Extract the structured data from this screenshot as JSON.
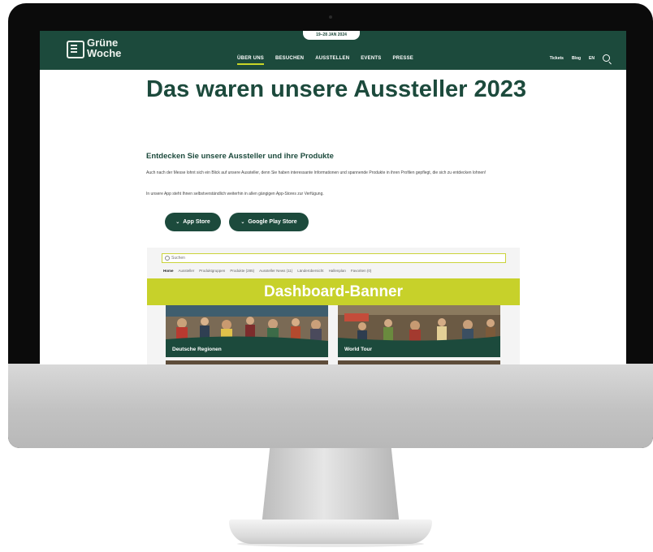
{
  "site": {
    "logo_line1": "Grüne",
    "logo_line2": "Woche",
    "date_badge": "19–28 JAN 2024",
    "menu": [
      "ÜBER UNS",
      "BESUCHEN",
      "AUSSTELLEN",
      "EVENTS",
      "PRESSE"
    ],
    "utility": {
      "tickets": "Tickets",
      "blog": "Blog",
      "lang": "EN"
    }
  },
  "content": {
    "title": "Das waren unsere Aussteller 2023",
    "subtitle": "Entdecken Sie unsere Aussteller und ihre Produkte",
    "paragraph1": "Auch nach der Messe lohnt sich ein Blick auf unsere Aussteller, denn Sie haben interessante Informationen und spannende Produkte in ihren Profilen gepflegt, die sich zu entdecken lohnen!",
    "paragraph2": "In unsere App steht Ihnen selbstverständlich weiterhin in allen gängigen App-Stores zur Verfügung.",
    "buttons": {
      "app_store": "App Store",
      "google_play": "Google Play Store"
    }
  },
  "embed": {
    "search_placeholder": "Suchen",
    "tabs": [
      "Home",
      "Aussteller",
      "Produktgruppen",
      "Produkte (285)",
      "Aussteller News (11)",
      "Länderübersicht",
      "Hallenplan",
      "Favoriten (0)"
    ],
    "banner": "Dashboard-Banner",
    "cards": [
      "Deutsche Regionen",
      "World Tour"
    ]
  },
  "colors": {
    "brand_green": "#1c4a3c",
    "accent_lime": "#c7d12a"
  }
}
